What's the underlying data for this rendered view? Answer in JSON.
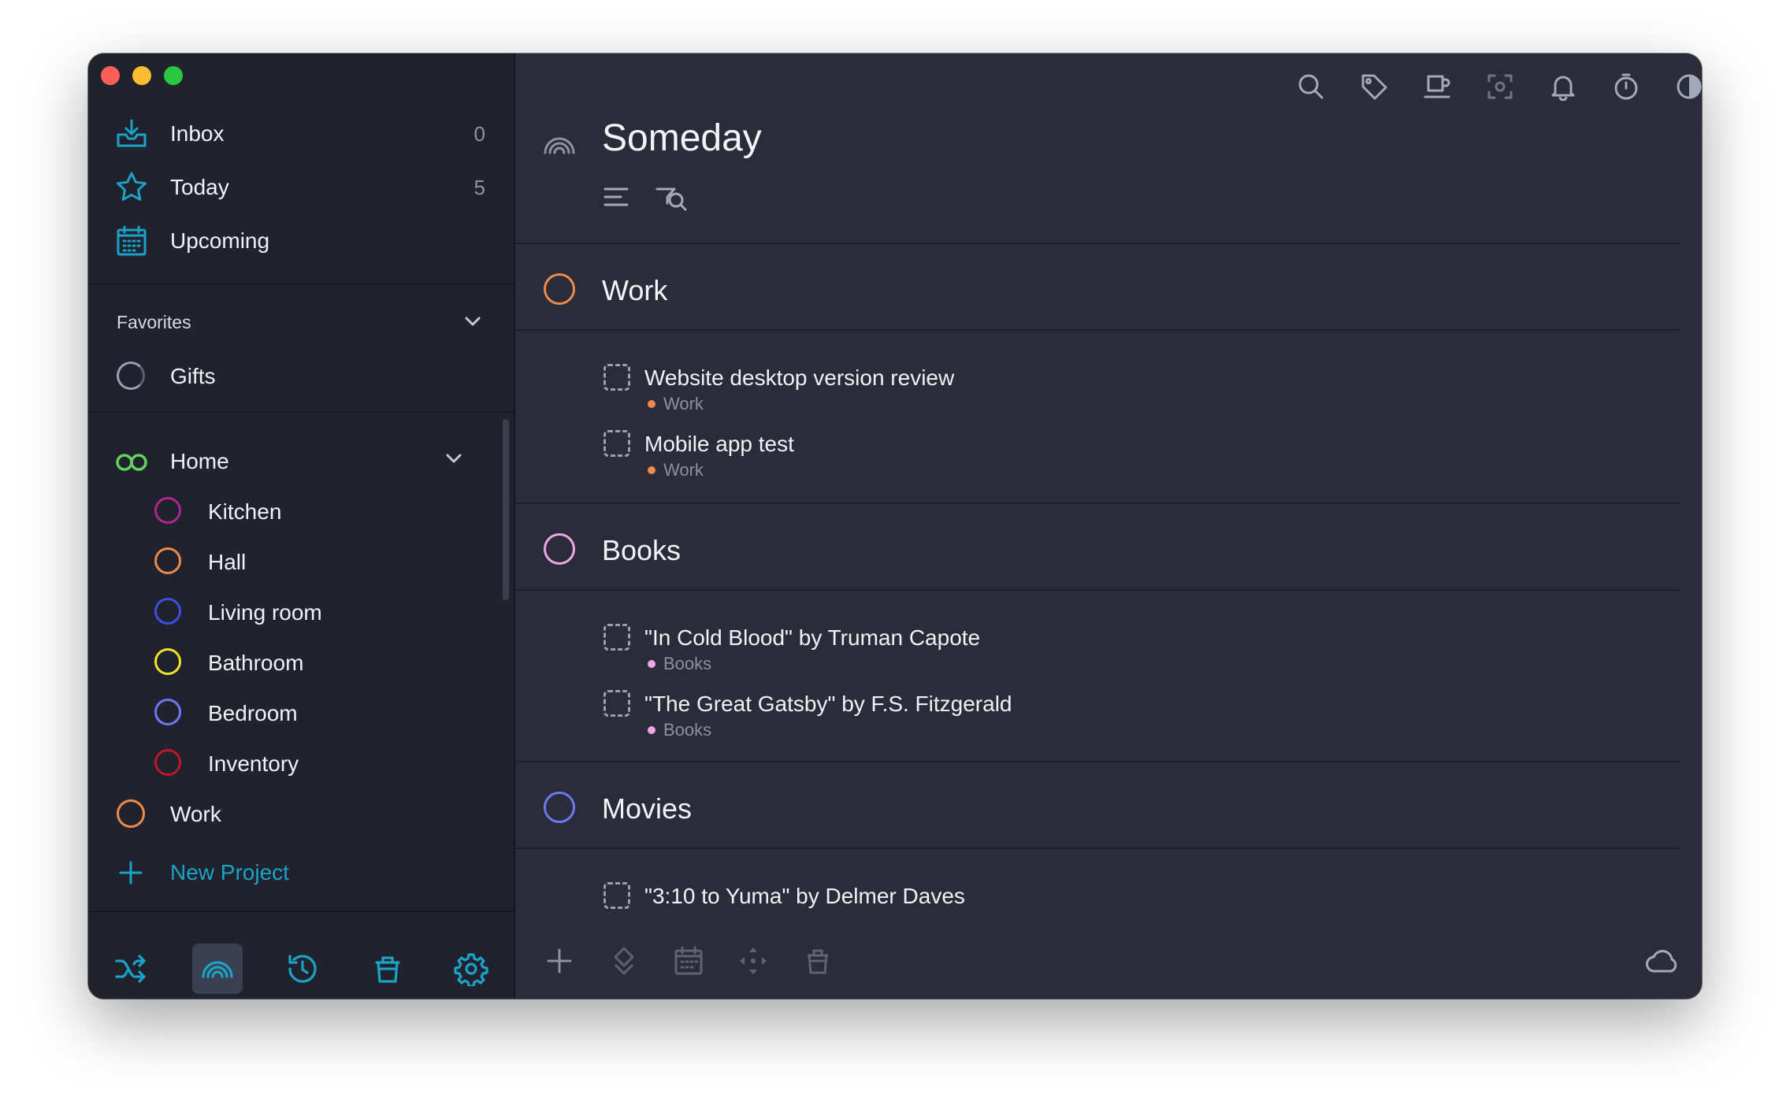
{
  "sidebar": {
    "nav": [
      {
        "label": "Inbox",
        "count": "0",
        "icon": "inbox-icon"
      },
      {
        "label": "Today",
        "count": "5",
        "icon": "star-icon"
      },
      {
        "label": "Upcoming",
        "count": "",
        "icon": "calendar-icon"
      }
    ],
    "favorites_title": "Favorites",
    "favorites": [
      {
        "label": "Gifts",
        "color": "#9aa0b3"
      }
    ],
    "home": {
      "label": "Home",
      "color": "#5fd35a",
      "areas": [
        {
          "label": "Kitchen",
          "color": "#b0258f"
        },
        {
          "label": "Hall",
          "color": "#f08a4b"
        },
        {
          "label": "Living room",
          "color": "#3d4fe0"
        },
        {
          "label": "Bathroom",
          "color": "#f3e52a"
        },
        {
          "label": "Bedroom",
          "color": "#6d7bf0"
        },
        {
          "label": "Inventory",
          "color": "#c0182b"
        }
      ]
    },
    "work": {
      "label": "Work",
      "color": "#f08a4b"
    },
    "new_project_label": "New Project",
    "bottom_icons": [
      "shuffle-icon",
      "someday-icon",
      "history-icon",
      "trash-icon",
      "settings-icon"
    ]
  },
  "main": {
    "title": "Someday",
    "top_icons": [
      "search-icon",
      "tag-icon",
      "coffee-icon",
      "focus-icon",
      "bell-icon",
      "timer-icon",
      "contrast-icon",
      "windows-icon"
    ],
    "groups": [
      {
        "label": "Work",
        "color": "#f08a4b",
        "tasks": [
          {
            "title": "Website desktop version review",
            "tag": "Work",
            "tag_color": "#f08a4b"
          },
          {
            "title": "Mobile app test",
            "tag": "Work",
            "tag_color": "#f08a4b"
          }
        ]
      },
      {
        "label": "Books",
        "color": "#f0a6e6",
        "tasks": [
          {
            "title": "\"In Cold Blood\" by Truman Capote",
            "tag": "Books",
            "tag_color": "#f0a6e6"
          },
          {
            "title": "\"The Great Gatsby\" by F.S. Fitzgerald",
            "tag": "Books",
            "tag_color": "#f0a6e6"
          }
        ]
      },
      {
        "label": "Movies",
        "color": "#6d7bf0",
        "tasks": [
          {
            "title": "\"3:10 to Yuma\" by Delmer Daves",
            "tag": "",
            "tag_color": ""
          }
        ]
      }
    ],
    "bottom_icons": [
      "add-icon",
      "move-icon",
      "schedule-icon",
      "arrange-icon",
      "delete-icon",
      "cloud-icon"
    ]
  },
  "colors": {
    "accent": "#1aa3c7",
    "sidebar_bg": "#20222d",
    "main_bg": "#2a2c39"
  }
}
